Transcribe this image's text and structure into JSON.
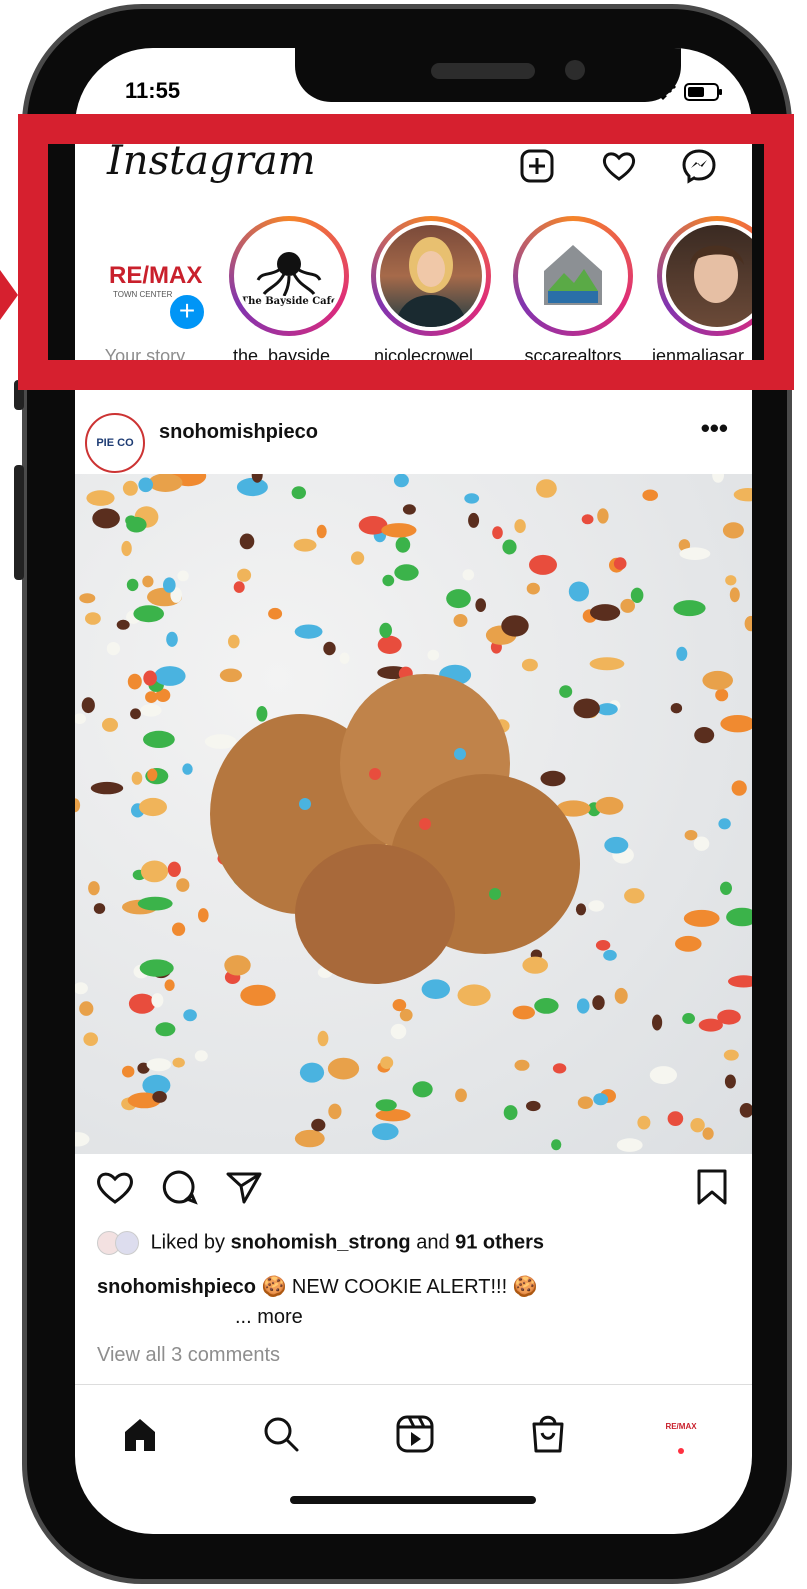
{
  "status_bar": {
    "time": "11:55"
  },
  "header": {
    "logo_text": "Instagram"
  },
  "stories": [
    {
      "label": "Your story",
      "avatar_text": "RE/MAX",
      "avatar_sub": "TOWN CENTER"
    },
    {
      "label": "the_bayside...",
      "avatar_text": "The Bayside Cafe"
    },
    {
      "label": "nicolecrowel..."
    },
    {
      "label": "sccarealtors"
    },
    {
      "label": "jenmaliasar"
    }
  ],
  "post": {
    "username": "snohomishpieco",
    "avatar_text": "PIE CO",
    "more": "•••",
    "liked_by_prefix": "Liked by ",
    "liked_by_user": "snohomish_strong",
    "liked_by_mid": " and ",
    "liked_by_count": "91 others",
    "caption_user": "snohomishpieco",
    "caption_text": "🍪 NEW COOKIE ALERT!!! 🍪",
    "caption_more": "... more",
    "comments": "View all 3 comments"
  },
  "tabbar": {
    "profile_avatar_text": "RE/MAX"
  },
  "colors": {
    "annotation": "#d6202f",
    "story_blue": "#0095f6",
    "notification": "#ff3040"
  }
}
